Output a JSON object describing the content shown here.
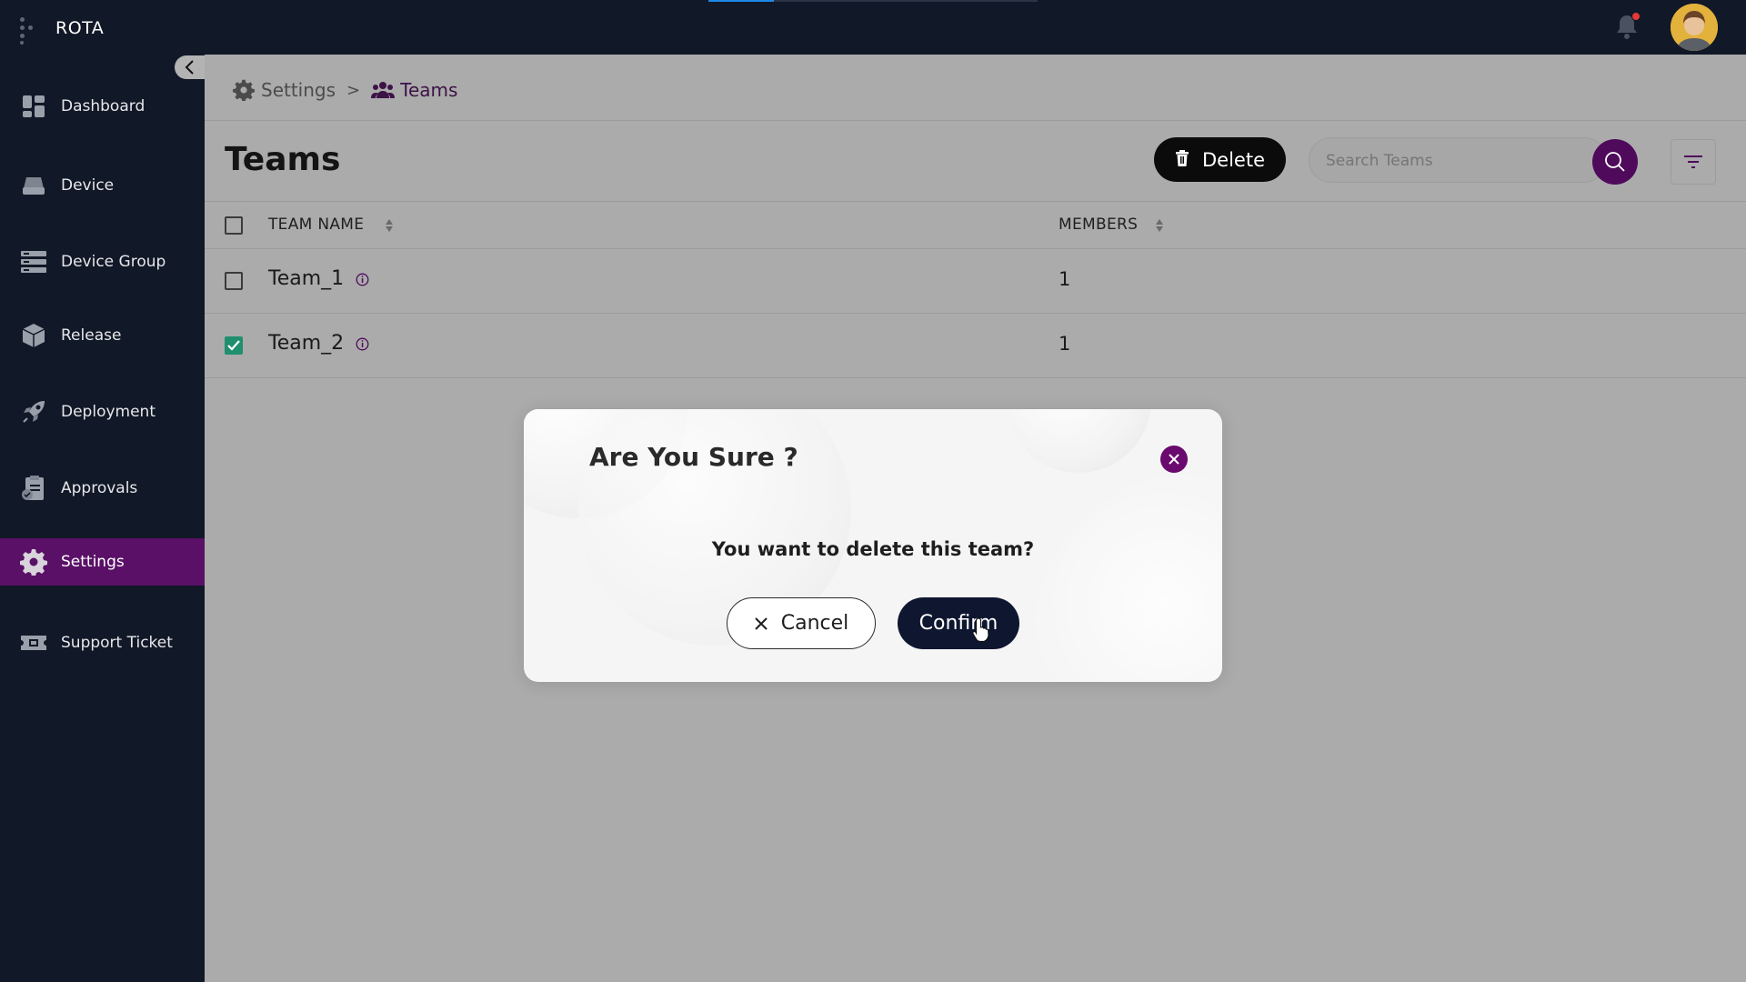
{
  "app": {
    "name": "ROTA"
  },
  "header": {
    "notification_icon": "bell-icon",
    "avatar": "user-avatar"
  },
  "sidebar": {
    "items": [
      {
        "label": "Dashboard",
        "icon": "dashboard-icon",
        "active": false
      },
      {
        "label": "Device",
        "icon": "device-icon",
        "active": false
      },
      {
        "label": "Device Group",
        "icon": "device-group-icon",
        "active": false
      },
      {
        "label": "Release",
        "icon": "release-icon",
        "active": false
      },
      {
        "label": "Deployment",
        "icon": "rocket-icon",
        "active": false
      },
      {
        "label": "Approvals",
        "icon": "approvals-icon",
        "active": false
      },
      {
        "label": "Settings",
        "icon": "gear-icon",
        "active": true
      },
      {
        "label": "Support Ticket",
        "icon": "ticket-icon",
        "active": false
      }
    ]
  },
  "breadcrumb": {
    "parent": "Settings",
    "separator": ">",
    "current": "Teams"
  },
  "page": {
    "title": "Teams",
    "delete_label": "Delete",
    "search_placeholder": "Search Teams"
  },
  "table": {
    "columns": [
      "TEAM NAME",
      "MEMBERS"
    ],
    "rows": [
      {
        "name": "Team_1",
        "members": "1",
        "checked": false
      },
      {
        "name": "Team_2",
        "members": "1",
        "checked": true
      }
    ]
  },
  "modal": {
    "title": "Are You Sure ?",
    "message": "You want to delete this team?",
    "cancel_label": "Cancel",
    "confirm_label": "Confirm"
  },
  "colors": {
    "sidebar_bg": "#111827",
    "active_item": "#5a1067",
    "accent_purple": "#4f0a5c",
    "checkbox_checked": "#1f8f6e",
    "confirm_btn": "#0e1630"
  }
}
